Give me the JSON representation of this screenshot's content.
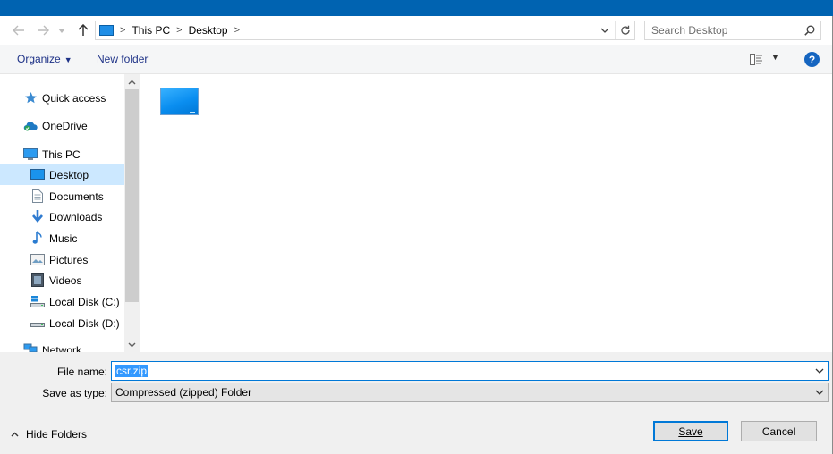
{
  "window": {
    "accent_color": "#0063b1"
  },
  "nav": {
    "back_icon": "arrow-left-icon",
    "forward_icon": "arrow-right-icon",
    "recent_icon": "chevron-down-icon",
    "up_icon": "arrow-up-icon",
    "breadcrumbs": [
      "This PC",
      "Desktop"
    ],
    "search_placeholder": "Search Desktop"
  },
  "toolbar": {
    "organize_label": "Organize",
    "new_folder_label": "New folder",
    "help_label": "?"
  },
  "sidebar": {
    "items": [
      {
        "label": "Quick access",
        "icon": "star-icon"
      },
      {
        "label": "OneDrive",
        "icon": "cloud-icon"
      },
      {
        "label": "This PC",
        "icon": "computer-icon"
      },
      {
        "label": "Desktop",
        "icon": "desktop-icon",
        "selected": true
      },
      {
        "label": "Documents",
        "icon": "document-icon"
      },
      {
        "label": "Downloads",
        "icon": "download-icon"
      },
      {
        "label": "Music",
        "icon": "music-icon"
      },
      {
        "label": "Pictures",
        "icon": "pictures-icon"
      },
      {
        "label": "Videos",
        "icon": "video-icon"
      },
      {
        "label": "Local Disk (C:)",
        "icon": "disk-icon"
      },
      {
        "label": "Local Disk (D:)",
        "icon": "disk-icon"
      },
      {
        "label": "Network",
        "icon": "network-icon"
      }
    ]
  },
  "form": {
    "file_name_label": "File name:",
    "file_name_value": "csr.zip",
    "save_type_label": "Save as type:",
    "save_type_value": "Compressed (zipped) Folder"
  },
  "footer": {
    "hide_folders_label": "Hide Folders",
    "save_label": "Save",
    "cancel_label": "Cancel"
  }
}
